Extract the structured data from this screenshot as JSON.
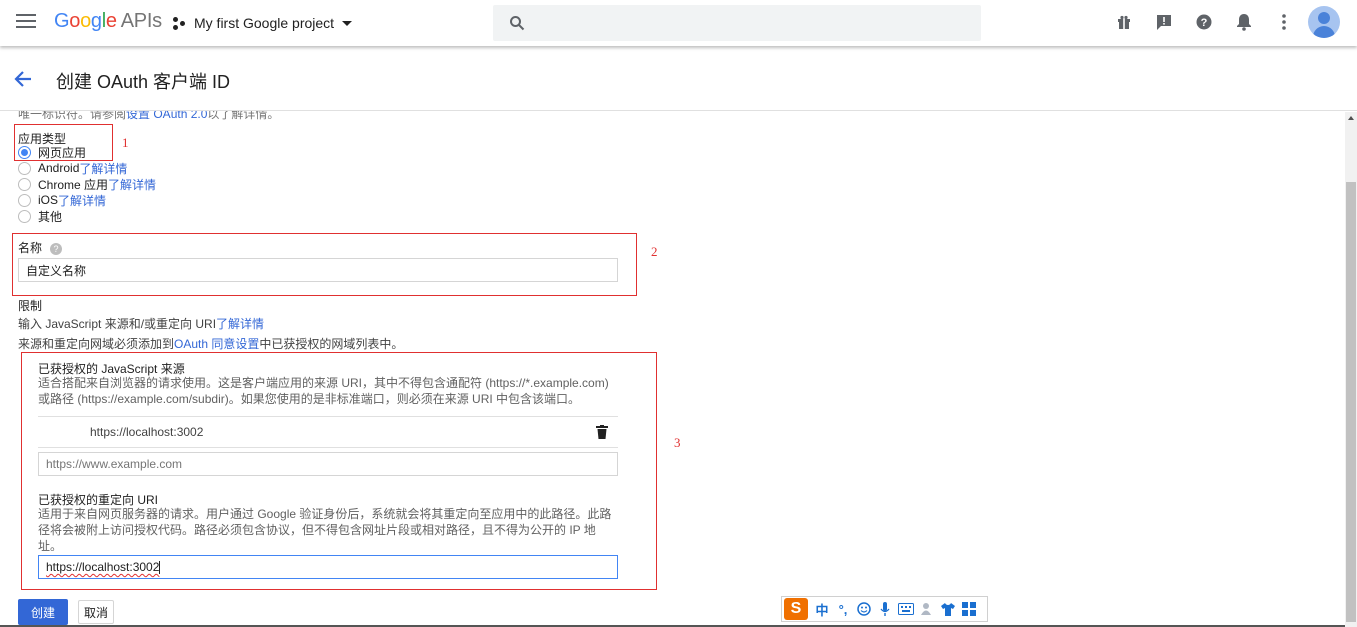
{
  "topbar": {
    "logo_google": "Google",
    "logo_apis": "APIs",
    "project_name": "My first Google project"
  },
  "page": {
    "title": "创建 OAuth 客户端 ID"
  },
  "intro": {
    "text": "唯一标识符。请参阅",
    "link": "设置 OAuth 2.0",
    "suffix": "以了解详情。"
  },
  "app_type": {
    "label": "应用类型",
    "options": [
      {
        "label": "网页应用",
        "link": "",
        "selected": true
      },
      {
        "label": "Android",
        "link": "了解详情",
        "selected": false
      },
      {
        "label": "Chrome 应用",
        "link": "了解详情",
        "selected": false
      },
      {
        "label": "iOS",
        "link": "了解详情",
        "selected": false
      },
      {
        "label": "其他",
        "link": "",
        "selected": false
      }
    ]
  },
  "name_field": {
    "label": "名称",
    "value": "自定义名称"
  },
  "restrictions": {
    "label": "限制",
    "desc1": "输入 JavaScript 来源和/或重定向 URI",
    "desc1_link": "了解详情",
    "desc2_prefix": "来源和重定向网域必须添加到",
    "desc2_link": "OAuth 同意设置",
    "desc2_suffix": "中已获授权的网域列表中。"
  },
  "js_origins": {
    "title": "已获授权的 JavaScript 来源",
    "desc_line1": "适合搭配来自浏览器的请求使用。这是客户端应用的来源 URI，其中不得包含通配符 (https://*.example.com)",
    "desc_line2": "或路径 (https://example.com/subdir)。如果您使用的是非标准端口，则必须在来源 URI 中包含该端口。",
    "existing": "https://localhost:3002",
    "placeholder": "https://www.example.com"
  },
  "redirect_uris": {
    "title": "已获授权的重定向 URI",
    "desc_line1": "适用于来自网页服务器的请求。用户通过 Google 验证身份后，系统就会将其重定向至应用中的此路径。此路",
    "desc_line2": "径将会被附上访问授权代码。路径必须包含协议，但不得包含网址片段或相对路径，且不得为公开的 IP 地",
    "desc_line3": "址。",
    "value": "https://localhost:3002"
  },
  "actions": {
    "create": "创建",
    "cancel": "取消"
  },
  "annotations": {
    "n1": "1",
    "n2": "2",
    "n3": "3"
  },
  "ime": {
    "logo": "S",
    "lang": "中"
  },
  "colors": {
    "accent": "#3367d6",
    "annotation_red": "#e03030",
    "selected_radio": "#4285f4"
  }
}
